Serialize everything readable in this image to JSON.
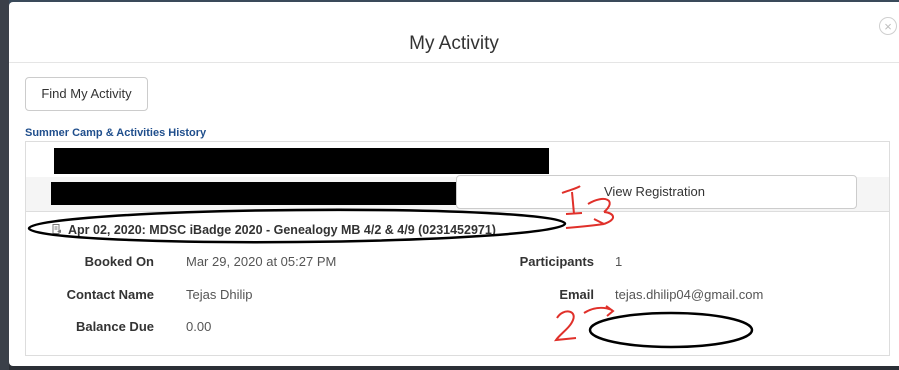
{
  "modal": {
    "title": "My Activity",
    "close_glyph": "×"
  },
  "toolbar": {
    "find_label": "Find My Activity"
  },
  "history": {
    "section_title": "Summer Camp & Activities History",
    "redacted_row_2_suffix": ")",
    "entry": {
      "icon": "document-icon",
      "header": "Apr 02, 2020: MDSC iBadge 2020 - Genealogy MB 4/2 & 4/9 (0231452971)",
      "booked_on_label": "Booked On",
      "booked_on_value": "Mar 29, 2020 at 05:27 PM",
      "participants_label": "Participants",
      "participants_value": "1",
      "contact_label": "Contact Name",
      "contact_value": "Tejas Dhilip",
      "email_label": "Email",
      "email_value": "tejas.dhilip04@gmail.com",
      "balance_label": "Balance Due",
      "balance_value": "0.00",
      "view_label": "View Registration"
    }
  },
  "annotations": {
    "color": "#e0302a",
    "marker_1": "1",
    "marker_2": "2"
  }
}
